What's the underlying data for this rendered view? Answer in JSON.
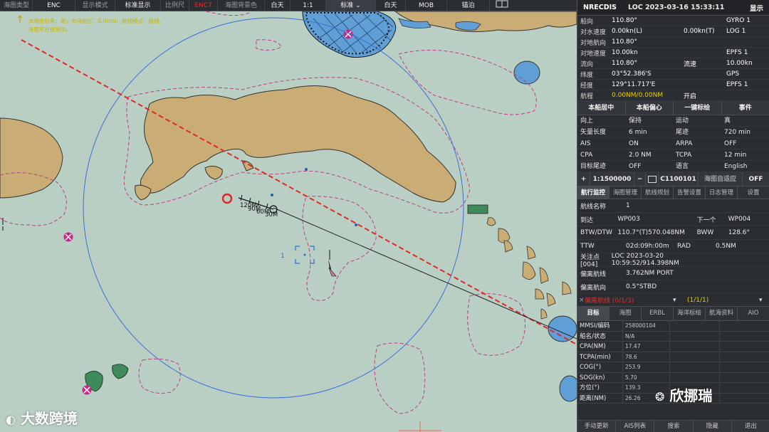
{
  "toolbar": {
    "items": [
      "海图类型",
      "ENC",
      "显示模式",
      "标准显示",
      "比例尺",
      "ENC7",
      "海图背景色",
      "白天",
      "1:1",
      "标准",
      "白天",
      "MOB",
      "锚泊"
    ]
  },
  "chart": {
    "notes": [
      "大地坐标系：是；大洋航区：0.0nmi；航线模式：航线。",
      "海图不在使用中。"
    ],
    "range_labels": [
      "120M",
      "90M",
      "60M",
      "30M"
    ],
    "target_label": "1",
    "scale_label": "1:1500000",
    "chart_id": "C1100101"
  },
  "watermarks": {
    "left": "大数跨境",
    "right": "欣挪瑞"
  },
  "panel": {
    "header": {
      "mode": "NRECDIS",
      "time": "LOC 2023-03-16 15:33:11",
      "display": "显示"
    },
    "nav": [
      {
        "k": "船向",
        "v": "110.80°",
        "v2": "",
        "v3": "GYRO 1"
      },
      {
        "k": "对水速度",
        "v": "0.00kn(L)",
        "v2": "0.00kn(T)",
        "v3": "LOG 1"
      },
      {
        "k": "对地航向",
        "v": "110.80°",
        "v2": "",
        "v3": ""
      },
      {
        "k": "对地速度",
        "v": "10.00kn",
        "v2": "",
        "v3": "EPFS 1"
      },
      {
        "k": "流向",
        "v": "110.80°",
        "v2": "流速",
        "v3": "10.00kn"
      },
      {
        "k": "纬度",
        "v": "03°52.386'S",
        "v2": "",
        "v3": "GPS"
      },
      {
        "k": "经度",
        "v": "129°11.717'E",
        "v2": "",
        "v3": "EPFS 1"
      },
      {
        "k": "航程",
        "v": "0.00NM/0.00NM",
        "v2": "开启",
        "v3": ""
      }
    ],
    "buttons1": [
      "本船居中",
      "本船偏心",
      "一键标绘",
      "事件"
    ],
    "settings": [
      [
        "向上",
        "保持",
        "运动",
        "真"
      ],
      [
        "矢量长度",
        "6 min",
        "尾迹",
        "720 min"
      ],
      [
        "AIS",
        "ON",
        "ARPA",
        "OFF"
      ],
      [
        "CPA",
        "2.0 NM",
        "TCPA",
        "12 min"
      ],
      [
        "目标尾迹",
        "OFF",
        "语言",
        "English"
      ]
    ],
    "scale": {
      "plus": "+",
      "scale": "1:1500000",
      "minus": "−",
      "chart": "C1100101",
      "auto_label": "海图自适应",
      "auto": "OFF"
    },
    "tabs": [
      "航行监控",
      "海图管理",
      "航线规划",
      "告警设置",
      "日志管理",
      "设置"
    ],
    "route": [
      {
        "k": "航线名称",
        "v": "1",
        "k2": "",
        "v2": ""
      },
      {
        "k": "到达",
        "v": "WP003",
        "k2": "下一个",
        "v2": "WP004"
      },
      {
        "k": "BTW/DTW",
        "v": "110.7°(T)570.048NM",
        "k2": "BWW",
        "v2": "128.6°"
      },
      {
        "k": "TTW",
        "v": "02d:09h:00m",
        "k2": "RAD",
        "v2": "0.5NM"
      },
      {
        "k": "关注点[004]",
        "v": "LOC 2023-03-20 10:59:52/914.398NM",
        "k2": "",
        "v2": ""
      },
      {
        "k": "偏离航线",
        "v": "3.762NM PORT",
        "k2": "",
        "v2": ""
      },
      {
        "k": "偏离航向",
        "v": "0.5°STBD",
        "k2": "",
        "v2": ""
      }
    ],
    "alarm": {
      "label": "偏离航线 (0/1/3)",
      "count": "(1/1/1)"
    },
    "target_tabs": [
      "目标",
      "海图",
      "ERBL",
      "海洋标绘",
      "航海资料",
      "AIO"
    ],
    "target_rows": [
      [
        "MMSI/编码",
        "258000104"
      ],
      [
        "船名/状态",
        "N/A"
      ],
      [
        "CPA(NM)",
        "17.47"
      ],
      [
        "TCPA(min)",
        "78.6"
      ],
      [
        "COG(°)",
        "253.9"
      ],
      [
        "SOG(kn)",
        "5.70"
      ],
      [
        "方位(°)",
        "139.3"
      ],
      [
        "距离(NM)",
        "26.26"
      ]
    ],
    "bottom": [
      "手动更新",
      "AIS列表",
      "搜索",
      "隐藏",
      "退出"
    ]
  },
  "colors": {
    "sea": "#b9cfc3",
    "land": "#c9ad74",
    "deep": "#5f9fd6",
    "danger": "#e02828",
    "contour": "#b8427e"
  }
}
